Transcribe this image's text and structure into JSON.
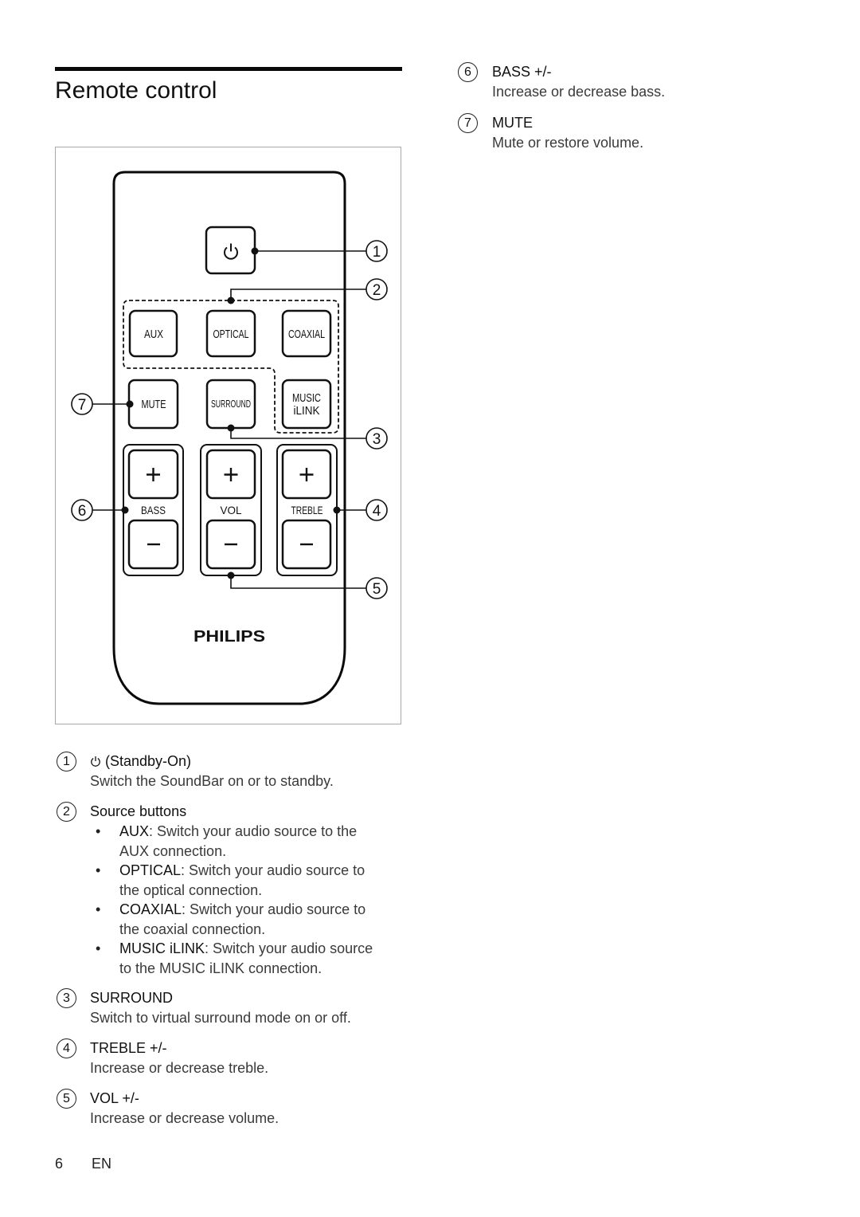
{
  "page": {
    "title": "Remote control",
    "page_number": "6",
    "language": "EN"
  },
  "figure": {
    "brand": "PHILIPS",
    "buttons": {
      "aux": "AUX",
      "optical": "OPTICAL",
      "coaxial": "COAXIAL",
      "mute": "MUTE",
      "surround": "SURROUND",
      "music_line1": "MUSIC",
      "music_line2": "iLINK"
    },
    "group_labels": {
      "bass": "BASS",
      "vol": "VOL",
      "treble": "TREBLE"
    },
    "callouts": [
      "1",
      "2",
      "3",
      "4",
      "5",
      "6",
      "7"
    ]
  },
  "items": [
    {
      "number": "1",
      "icon": "power-icon",
      "heading": "(Standby-On)",
      "description": "Switch the SoundBar on or to standby."
    },
    {
      "number": "2",
      "heading": "Source buttons",
      "bullets": [
        {
          "term": "AUX",
          "text": ": Switch your audio source to the AUX connection."
        },
        {
          "term": "OPTICAL",
          "text": ": Switch your audio source to the optical connection."
        },
        {
          "term": "COAXIAL",
          "text": ": Switch your audio source to the coaxial connection."
        },
        {
          "term": "MUSIC iLINK",
          "text": ": Switch your audio source to the MUSIC iLINK connection."
        }
      ]
    },
    {
      "number": "3",
      "heading": "SURROUND",
      "description": "Switch to virtual surround mode on or off."
    },
    {
      "number": "4",
      "heading": "TREBLE +/-",
      "description": "Increase or decrease treble."
    },
    {
      "number": "5",
      "heading": "VOL +/-",
      "description": "Increase or decrease volume."
    },
    {
      "number": "6",
      "heading": "BASS +/-",
      "description": "Increase or decrease bass."
    },
    {
      "number": "7",
      "heading": "MUTE",
      "description": "Mute or restore volume."
    }
  ]
}
